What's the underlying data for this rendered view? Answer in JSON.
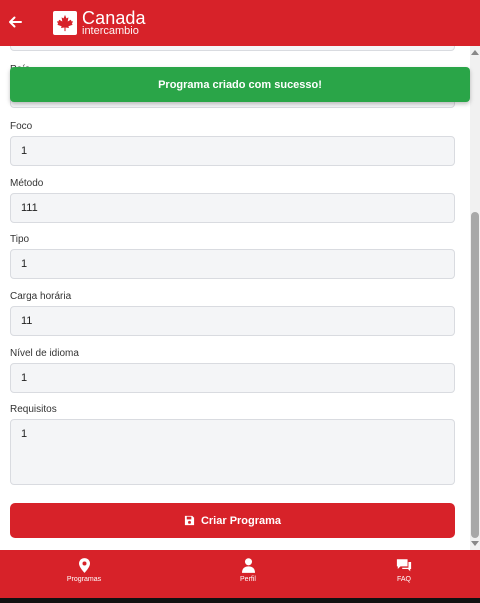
{
  "header": {
    "back_icon": "arrow-left-icon",
    "logo_icon": "maple-leaf-icon",
    "logo_title": "Canada",
    "logo_subtitle": "intercambio",
    "background": "#d72229"
  },
  "toast": {
    "message": "Programa criado com sucesso!",
    "color": "#2aa548"
  },
  "partial_label": "País",
  "fields": [
    {
      "label": "Foco",
      "value": "1"
    },
    {
      "label": "Método",
      "value": "111"
    },
    {
      "label": "Tipo",
      "value": "1"
    },
    {
      "label": "Carga horária",
      "value": "11"
    },
    {
      "label": "Nível de idioma",
      "value": "1"
    },
    {
      "label": "Requisitos",
      "value": "1"
    }
  ],
  "submit": {
    "label": "Criar Programa",
    "icon": "save-icon"
  },
  "bottom_nav": [
    {
      "label": "Programas",
      "icon": "map-pin-icon"
    },
    {
      "label": "Perfil",
      "icon": "user-icon"
    },
    {
      "label": "FAQ",
      "icon": "chat-bubbles-icon"
    }
  ]
}
